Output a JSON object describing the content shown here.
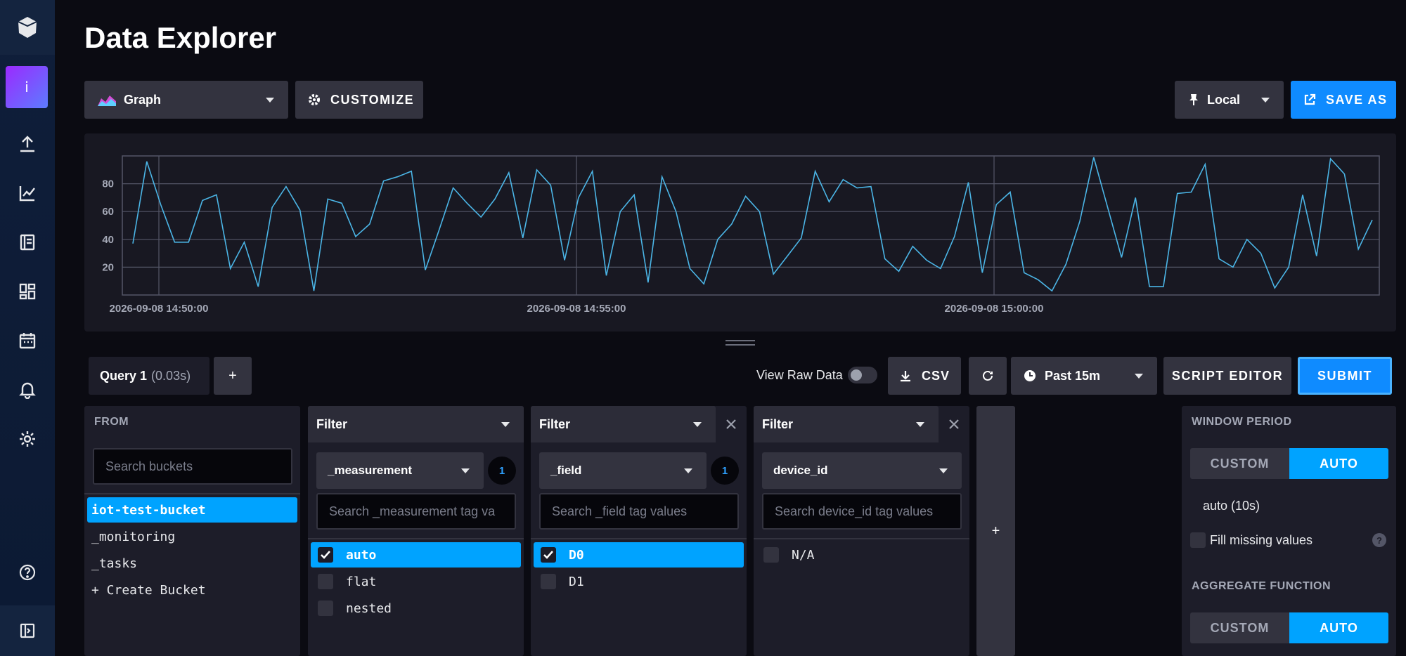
{
  "page": {
    "title": "Data Explorer"
  },
  "nav": {
    "active_label": "i",
    "icons": [
      "upload-icon",
      "graph-icon",
      "notebook-icon",
      "dashboards-icon",
      "tasks-calendar-icon",
      "alerts-bell-icon",
      "settings-gear-icon",
      "help-icon",
      "collapse-nav-icon"
    ]
  },
  "toolbar": {
    "vis_type": "Graph",
    "customize": "CUSTOMIZE",
    "timezone": "Local",
    "save_as": "SAVE AS"
  },
  "chart_data": {
    "type": "line",
    "y_ticks": [
      "80",
      "60",
      "40",
      "20"
    ],
    "x_ticks": [
      "2026-09-08 14:50:00",
      "2026-09-08 14:55:00",
      "2026-09-08 15:00:00"
    ],
    "ylim": [
      0,
      100
    ],
    "series": [
      {
        "color": "#4bb5e6",
        "values": [
          37,
          96,
          65,
          38,
          38,
          68,
          72,
          19,
          38,
          6,
          63,
          78,
          61,
          3,
          69,
          66,
          42,
          51,
          82,
          85,
          89,
          18,
          47,
          77,
          66,
          56,
          69,
          88,
          41,
          90,
          79,
          25,
          70,
          89,
          14,
          60,
          72,
          9,
          85,
          60,
          19,
          8,
          40,
          51,
          71,
          60,
          15,
          28,
          41,
          89,
          67,
          83,
          77,
          78,
          26,
          17,
          35,
          25,
          19,
          42,
          81,
          16,
          65,
          74,
          16,
          11,
          3,
          22,
          53,
          99,
          63,
          27,
          70,
          6,
          6,
          73,
          74,
          94,
          26,
          20,
          40,
          30,
          5,
          20,
          72,
          28,
          98,
          87,
          33,
          54
        ]
      }
    ]
  },
  "query_bar": {
    "query_tab": "Query 1",
    "query_time": "(0.03s)",
    "add": "+",
    "view_raw": "View Raw Data",
    "csv": "CSV",
    "time_range": "Past 15m",
    "script_editor": "SCRIPT EDITOR",
    "submit": "SUBMIT"
  },
  "from_panel": {
    "title": "FROM",
    "search_placeholder": "Search buckets",
    "buckets": [
      "iot-test-bucket",
      "_monitoring",
      "_tasks",
      "+ Create Bucket"
    ],
    "selected": "iot-test-bucket"
  },
  "filters": [
    {
      "head": "Filter",
      "key": "_measurement",
      "count": "1",
      "search_placeholder": "Search _measurement tag va",
      "values": [
        "auto",
        "flat",
        "nested"
      ],
      "selected": "auto"
    },
    {
      "head": "Filter",
      "key": "_field",
      "count": "1",
      "search_placeholder": "Search _field tag values",
      "values": [
        "D0",
        "D1"
      ],
      "selected": "D0"
    },
    {
      "head": "Filter",
      "key": "device_id",
      "search_placeholder": "Search device_id tag values",
      "values": [
        "N/A"
      ]
    }
  ],
  "add_filter": "+",
  "window_panel": {
    "window_period_label": "WINDOW PERIOD",
    "custom": "CUSTOM",
    "auto": "AUTO",
    "auto_value": "auto (10s)",
    "fill_missing": "Fill missing values",
    "help": "?",
    "aggregate_label": "AGGREGATE FUNCTION"
  },
  "colors": {
    "accent": "#00a3ff",
    "line": "#4bb5e6",
    "panel": "#1d1d29"
  }
}
